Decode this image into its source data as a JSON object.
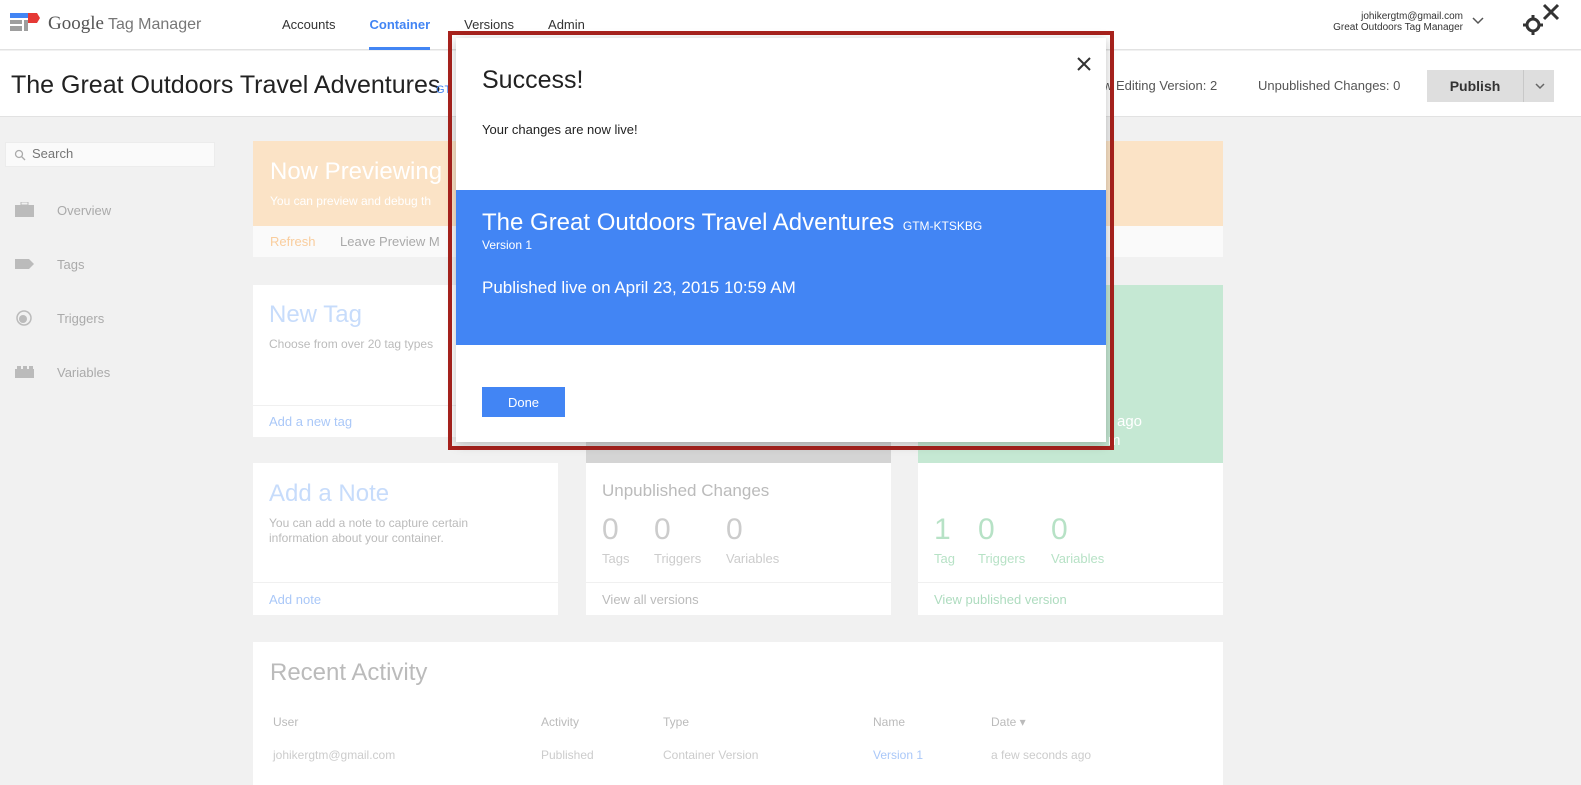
{
  "app": {
    "logo_google": "Google",
    "logo_product": "Tag Manager",
    "nav": [
      "Accounts",
      "Container",
      "Versions",
      "Admin"
    ],
    "active_nav": "Container",
    "account_email": "johikergtm@gmail.com",
    "account_name": "Great Outdoors Tag Manager"
  },
  "container": {
    "title": "The Great Outdoors Travel Adventures",
    "id_partial": "GT",
    "editing_version": "w Editing Version: 2",
    "unpublished_changes": "Unpublished Changes: 0",
    "publish_label": "Publish"
  },
  "sidebar": {
    "search_placeholder": "Search",
    "items": [
      {
        "label": "Overview",
        "icon": "briefcase-icon"
      },
      {
        "label": "Tags",
        "icon": "tag-icon"
      },
      {
        "label": "Triggers",
        "icon": "trigger-icon"
      },
      {
        "label": "Variables",
        "icon": "blocks-icon"
      }
    ]
  },
  "preview": {
    "title": "Now Previewing",
    "subtitle": "You can preview and debug th",
    "refresh": "Refresh",
    "leave": "Leave Preview M"
  },
  "tag_card": {
    "title": "New Tag",
    "desc": "Choose from over 20 tag types",
    "link": "Add a new tag"
  },
  "green_card": {
    "ago": "ago",
    "m": "m"
  },
  "note_card": {
    "title": "Add a Note",
    "desc_line1": "You can add a note to capture certain",
    "desc_line2": "information about your container.",
    "link": "Add note"
  },
  "unpublished_card": {
    "title": "Unpublished Changes",
    "stats": [
      {
        "num": "0",
        "label": "Tags"
      },
      {
        "num": "0",
        "label": "Triggers"
      },
      {
        "num": "0",
        "label": "Variables"
      }
    ],
    "link": "View all versions"
  },
  "published_card": {
    "stats": [
      {
        "num": "1",
        "label": "Tag"
      },
      {
        "num": "0",
        "label": "Triggers"
      },
      {
        "num": "0",
        "label": "Variables"
      }
    ],
    "link": "View published version"
  },
  "recent": {
    "title": "Recent Activity",
    "headers": [
      "User",
      "Activity",
      "Type",
      "Name",
      "Date ▾"
    ],
    "row": [
      "johikergtm@gmail.com",
      "Published",
      "Container Version",
      "Version 1",
      "a few seconds ago"
    ]
  },
  "dialog": {
    "title": "Success!",
    "message": "Your changes are now live!",
    "container_name": "The Great Outdoors Travel Adventures",
    "container_id": "GTM-KTSKBG",
    "version": "Version 1",
    "published": "Published live on April 23, 2015 10:59 AM",
    "done_label": "Done"
  },
  "colors": {
    "accent": "#4285f4",
    "highlight_frame": "#a8221d",
    "preview_orange": "#fbe3c6",
    "published_green": "#c5e8d3"
  }
}
